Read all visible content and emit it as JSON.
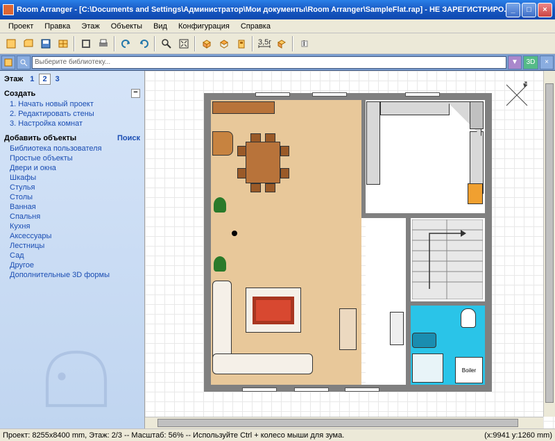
{
  "titlebar": {
    "app_name": "Room Arranger",
    "file_path": "[C:\\Documents and Settings\\Администратор\\Мои документы\\Room Arranger\\SampleFlat.rap]",
    "status": "- НЕ ЗАРЕГИСТРИРО..."
  },
  "menu": {
    "items": [
      "Проект",
      "Правка",
      "Этаж",
      "Объекты",
      "Вид",
      "Конфигурация",
      "Справка"
    ]
  },
  "toolbar": {
    "icons": [
      "new",
      "open",
      "save",
      "print",
      "undo",
      "redo",
      "zoom",
      "fitscreen",
      "3d",
      "measure",
      "library",
      "help"
    ]
  },
  "sidebar_toolbar": {
    "search_placeholder": "Выберите библиотеку...",
    "btn_3d": "3D"
  },
  "sidebar": {
    "floor_label": "Этаж",
    "floors": [
      "1",
      "2",
      "3"
    ],
    "active_floor": 1,
    "create_section": {
      "title": "Создать",
      "items": [
        "1. Начать новый проект",
        "2. Редактировать стены",
        "3. Настройка комнат"
      ]
    },
    "add_section": {
      "title": "Добавить объекты",
      "search_label": "Поиск",
      "items": [
        "Библиотека пользователя",
        "Простые объекты",
        "Двери и окна",
        "Шкафы",
        "Стулья",
        "Столы",
        "Ванная",
        "Спальня",
        "Кухня",
        "Аксессуары",
        "Лестницы",
        "Сад",
        "Другое",
        "Дополнительные 3D формы"
      ]
    }
  },
  "canvas": {
    "compass": true,
    "bathroom_label": "Boiler"
  },
  "statusbar": {
    "left": "Проект: 8255x8400 mm, Этаж: 2/3 -- Масштаб: 56% -- Используйте Ctrl + колесо мыши для зума.",
    "right": "(x:9941 y:1260 mm)"
  }
}
